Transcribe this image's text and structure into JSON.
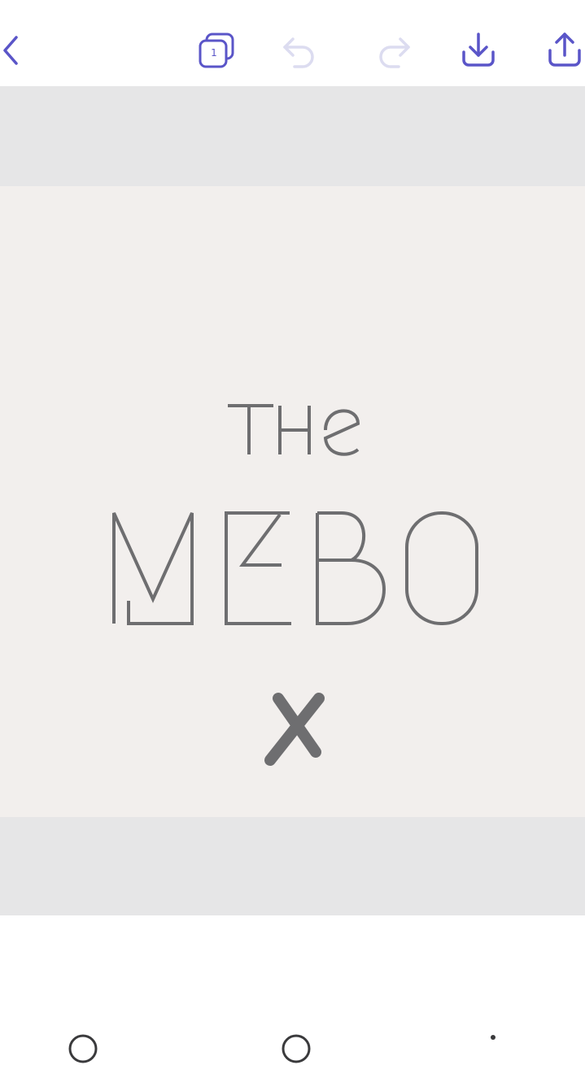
{
  "toolbar": {
    "back_icon": "chevron-left-icon",
    "pages_icon": "pages-stack-icon",
    "pages_count": "1",
    "undo_icon": "undo-icon",
    "redo_icon": "redo-icon",
    "download_icon": "download-icon",
    "share_icon": "share-icon",
    "accent_color": "#5a55c8",
    "disabled_color": "#dcdcf0"
  },
  "design": {
    "background_color": "#f2efed",
    "text_color": "#6e6e70",
    "line1": "THE",
    "line2": "MEBO",
    "line3": "X"
  },
  "canvas": {
    "background_color": "#e6e6e7"
  }
}
